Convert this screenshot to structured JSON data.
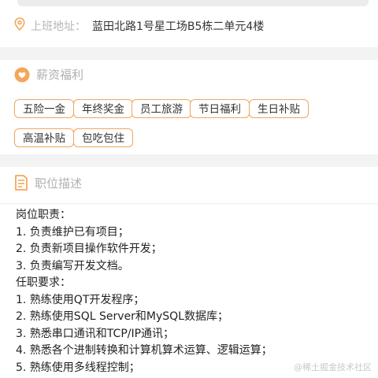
{
  "address": {
    "label": "上班地址：",
    "value": "蓝田北路1号星工场B5栋二单元4楼"
  },
  "welfare": {
    "title": "薪资福利",
    "tags": [
      "五险一金",
      "年终奖金",
      "员工旅游",
      "节日福利",
      "生日补贴",
      "高温补贴",
      "包吃包住"
    ]
  },
  "description": {
    "title": "职位描述",
    "lines": [
      "岗位职责：",
      "1. 负责维护已有项目；",
      "2. 负责新项目操作软件开发；",
      "3. 负责编写开发文档。",
      "任职要求：",
      "1. 熟练使用QT开发程序；",
      "2. 熟练使用SQL Server和MySQL数据库；",
      "3. 熟悉串口通讯和TCP/IP通讯；",
      "4. 熟悉各个进制转换和计算机算术运算、逻辑运算；",
      "5. 熟练使用多线程控制；"
    ]
  },
  "watermark": "@稀土掘金技术社区",
  "colors": {
    "accent": "#f0a560",
    "icon": "#f5a65b"
  }
}
